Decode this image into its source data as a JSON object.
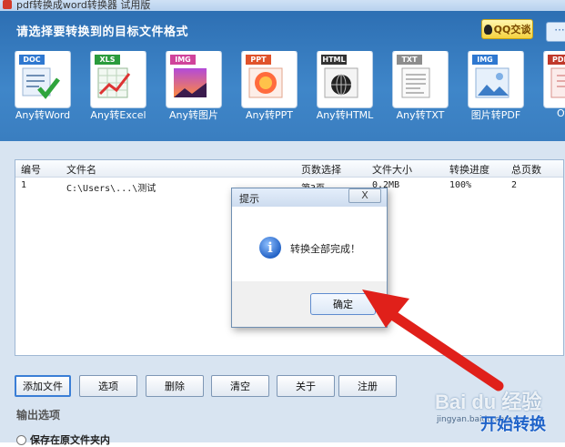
{
  "window": {
    "title": "pdf转换成word转换器 试用版"
  },
  "header": {
    "prompt": "请选择要转换到的目标文件格式",
    "qq_button": "QQ交谈",
    "formats": [
      {
        "badge": "DOC",
        "label": "Any转Word",
        "color": "#2f78d0"
      },
      {
        "badge": "XLS",
        "label": "Any转Excel",
        "color": "#2a9b3c"
      },
      {
        "badge": "IMG",
        "label": "Any转图片",
        "color": "#d0439b"
      },
      {
        "badge": "PPT",
        "label": "Any转PPT",
        "color": "#e0532b"
      },
      {
        "badge": "HTML",
        "label": "Any转HTML",
        "color": "#333333"
      },
      {
        "badge": "TXT",
        "label": "Any转TXT",
        "color": "#8d8d8d"
      },
      {
        "badge": "IMG",
        "label": "图片转PDF",
        "color": "#2f78d0"
      },
      {
        "badge": "PDF",
        "label": "Office",
        "color": "#c0392b"
      }
    ]
  },
  "table": {
    "columns": [
      "编号",
      "文件名",
      "页数选择",
      "文件大小",
      "转换进度",
      "总页数"
    ],
    "rows": [
      {
        "id": "1",
        "name": "C:\\Users\\...\\测试",
        "pages": "第3页",
        "size": "0.2MB",
        "progress": "100%",
        "total": "2"
      }
    ]
  },
  "toolbar": {
    "add": "添加文件",
    "options": "选项",
    "delete": "删除",
    "clear": "清空",
    "about": "关于",
    "register": "注册"
  },
  "output": {
    "label": "输出选项",
    "save_original": "保存在原文件夹内"
  },
  "dialog": {
    "title": "提示",
    "close": "X",
    "message": "转换全部完成！",
    "ok": "确定"
  },
  "watermark": {
    "brand": "Bai du 经验",
    "sub": "jingyan.baidu.com",
    "action": "开始转换"
  },
  "colors": {
    "header": "#3f86c9",
    "arrow": "#e0201a",
    "accent": "#3a7ed6"
  }
}
